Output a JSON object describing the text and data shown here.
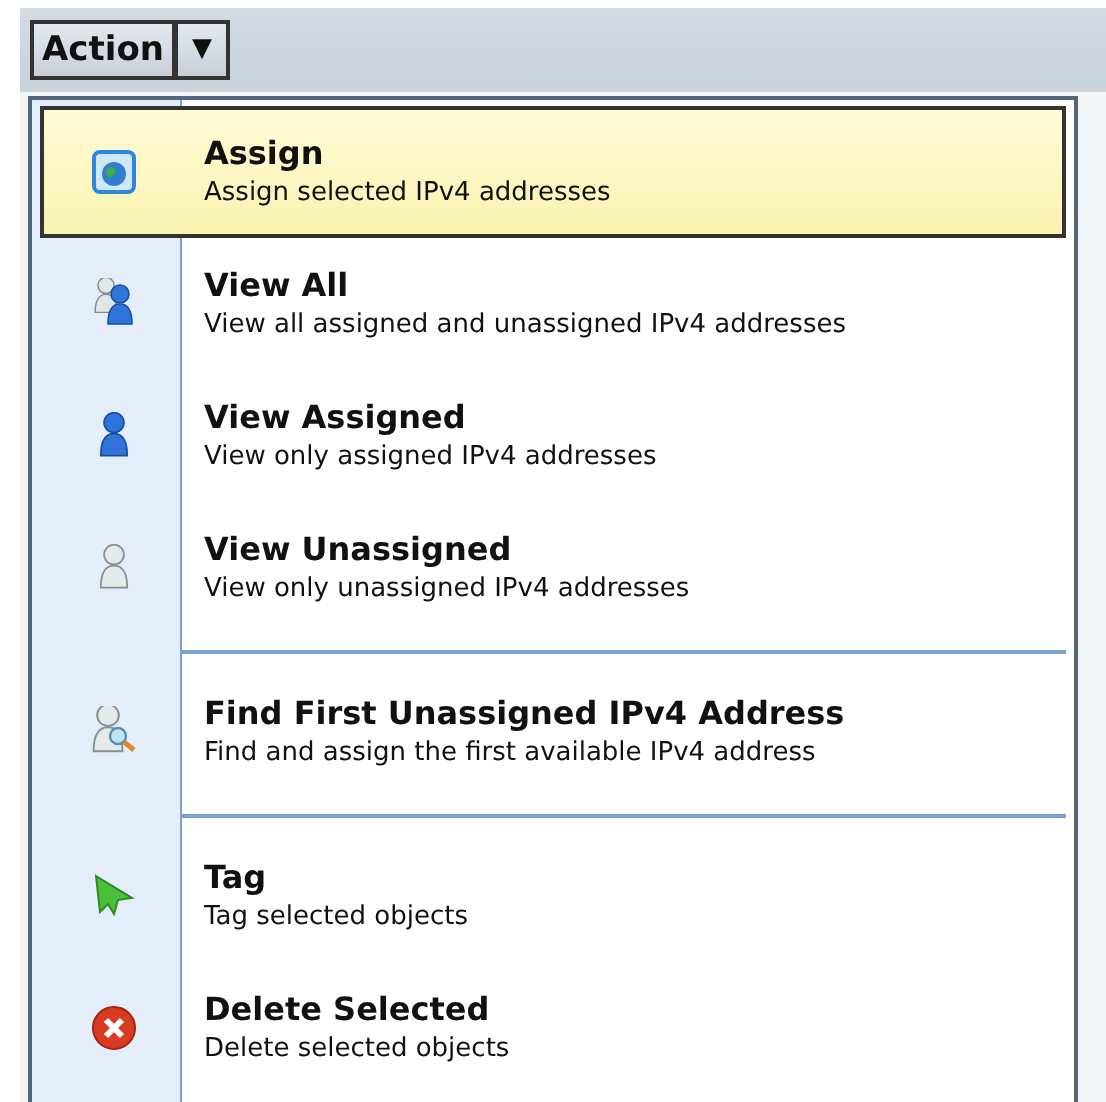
{
  "toolbar": {
    "action_button": "Action",
    "dropdown_arrow": "▼"
  },
  "menu": {
    "groups": [
      {
        "items": [
          {
            "kind": "assign",
            "title": "Assign",
            "description": "Assign selected IPv4 addresses",
            "selected": true
          },
          {
            "kind": "view-all",
            "title": "View All",
            "description": "View all assigned and unassigned IPv4 addresses",
            "selected": false
          },
          {
            "kind": "view-assigned",
            "title": "View Assigned",
            "description": "View only assigned IPv4 addresses",
            "selected": false
          },
          {
            "kind": "view-unassigned",
            "title": "View Unassigned",
            "description": "View only unassigned IPv4 addresses",
            "selected": false
          }
        ]
      },
      {
        "items": [
          {
            "kind": "find",
            "title": "Find First Unassigned IPv4 Address",
            "description": "Find and assign the first available IPv4 address",
            "selected": false
          }
        ]
      },
      {
        "items": [
          {
            "kind": "tag",
            "title": "Tag",
            "description": "Tag selected objects",
            "selected": false
          },
          {
            "kind": "delete",
            "title": "Delete Selected",
            "description": "Delete selected objects",
            "selected": false
          }
        ]
      }
    ]
  }
}
